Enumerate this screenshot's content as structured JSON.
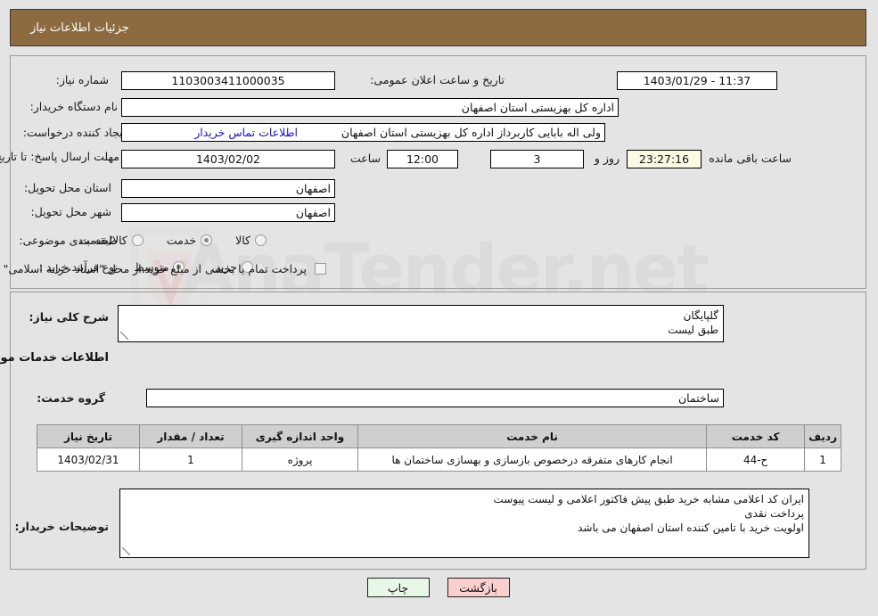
{
  "header": {
    "title": "جزئیات اطلاعات نیاز"
  },
  "form": {
    "need_number_label": "شماره نیاز:",
    "need_number_value": "1103003411000035",
    "announce_datetime_label": "تاریخ و ساعت اعلان عمومی:",
    "announce_datetime_value": "11:37 - 1403/01/29",
    "buyer_org_label": "نام دستگاه خریدار:",
    "buyer_org_value": "اداره کل بهزیستی استان اصفهان",
    "requester_label": "ایجاد کننده درخواست:",
    "requester_value": "ولی اله بابایی کاربرداز اداره کل بهزیستی استان اصفهان",
    "buyer_contact_link": "اطلاعات تماس خریدار",
    "deadline_label": "مهلت ارسال پاسخ: تا تاریخ:",
    "deadline_date": "1403/02/02",
    "deadline_hour_label": "ساعت",
    "deadline_hour_value": "12:00",
    "remaining_days_value": "3",
    "remaining_days_sep": "روز و",
    "remaining_time_value": "23:27:16",
    "remaining_suffix": "ساعت باقی مانده",
    "province_label": "استان محل تحویل:",
    "province_value": "اصفهان",
    "city_label": "شهر محل تحویل:",
    "city_value": "اصفهان",
    "category_label": "طبقه بندی موضوعی:",
    "category_options": [
      {
        "label": "کالا",
        "selected": false
      },
      {
        "label": "خدمت",
        "selected": true
      },
      {
        "label": "کالا/خدمت",
        "selected": false
      }
    ],
    "process_label": "نوع فرآیند خرید :",
    "process_options": [
      {
        "label": "جزیی",
        "selected": false
      },
      {
        "label": "متوسط",
        "selected": true
      }
    ],
    "treasury_checkbox_checked": false,
    "treasury_note": "پرداخت تمام یا بخشی از مبلغ خرید،از محل \"اسناد خزانه اسلامی\" خواهد بود."
  },
  "details": {
    "general_desc_label": "شرح کلی نیاز:",
    "general_desc_value": "گلپایگان\nطبق لیست",
    "services_section_title": "اطلاعات خدمات مورد نیاز",
    "service_group_label": "گروه خدمت:",
    "service_group_value": "ساختمان"
  },
  "table": {
    "columns": [
      "ردیف",
      "کد خدمت",
      "نام خدمت",
      "واحد اندازه گیری",
      "تعداد / مقدار",
      "تاریخ نیاز"
    ],
    "rows": [
      {
        "row_no": "1",
        "service_code": "ح-44",
        "service_name": "انجام کارهای متفرقه درخصوص بازسازی و بهسازی ساختمان ها",
        "unit": "پروژه",
        "quantity": "1",
        "need_date": "1403/02/31"
      }
    ]
  },
  "buyer_notes": {
    "label": "توضیحات خریدار:",
    "value": "ایران کد اعلامی مشابه خرید طبق پیش فاکتور اعلامی و لیست پیوست\nپرداخت نقدی\nاولویت خرید با تامین کننده استان اصفهان  می باشد"
  },
  "buttons": {
    "print_label": "چاپ",
    "back_label": "بازگشت"
  },
  "watermark": {
    "text": "AnaTender.net"
  },
  "colors": {
    "header_bg": "#8d6b41",
    "page_bg": "#e4e4e4",
    "link": "#1414cc",
    "countdown_bg": "#fbfbe4",
    "print_btn_bg": "#e9f7e9",
    "back_btn_bg": "#f9cfcf",
    "table_header_bg": "#cfcfcf"
  }
}
